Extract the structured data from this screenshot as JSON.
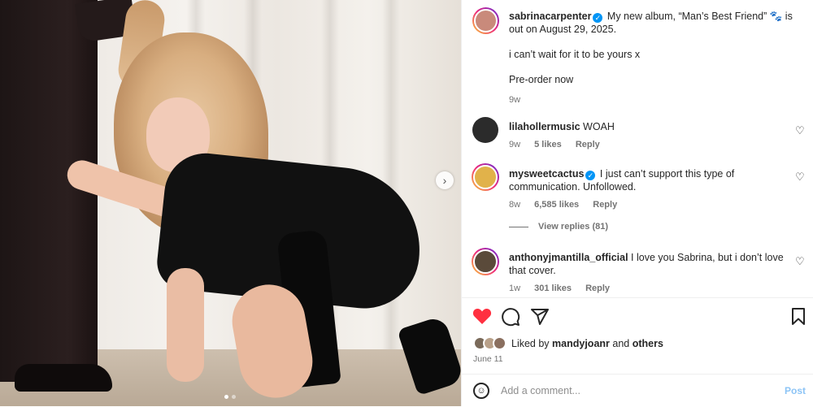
{
  "author": {
    "username": "sabrinacarpenter",
    "verified": true,
    "avatar_color": "#c98a7b"
  },
  "caption": {
    "line1": "My new album, “Man’s Best Friend” 🐾 is out on August 29, 2025.",
    "line2": "i can’t wait for it to be yours x",
    "line3": "Pre-order now",
    "time": "9w"
  },
  "comments": [
    {
      "username": "lilahollermusic",
      "verified": false,
      "text": "WOAH",
      "time": "9w",
      "likes": "5 likes",
      "reply": "Reply",
      "avatar_color": "#2b2b2b"
    },
    {
      "username": "mysweetcactus",
      "verified": true,
      "text": "I just can’t support this type of communication. Unfollowed.",
      "time": "8w",
      "likes": "6,585 likes",
      "reply": "Reply",
      "avatar_color": "#e1b24a"
    },
    {
      "username": "anthonyjmantilla_official",
      "verified": false,
      "text": "I love you Sabrina, but i don’t love that cover.",
      "time": "1w",
      "likes": "301 likes",
      "reply": "Reply",
      "avatar_color": "#5a4a3a"
    }
  ],
  "view_replies": "View replies (81)",
  "likes": {
    "prefix": "Liked by",
    "user": "mandyjoanr",
    "joiner": "and",
    "others": "others"
  },
  "date": "June 11",
  "add_comment": {
    "placeholder": "Add a comment...",
    "post_label": "Post"
  },
  "carousel": {
    "total": 2,
    "current": 1
  },
  "icons": {
    "like": "heart-filled-icon",
    "comment": "comment-icon",
    "share": "send-icon",
    "save": "bookmark-icon",
    "emoji": "emoji-icon",
    "next": "chevron-right-icon"
  },
  "colors": {
    "like_red": "#ff3040",
    "verified_blue": "#0095f6",
    "post_blue": "#8cc4f6"
  }
}
